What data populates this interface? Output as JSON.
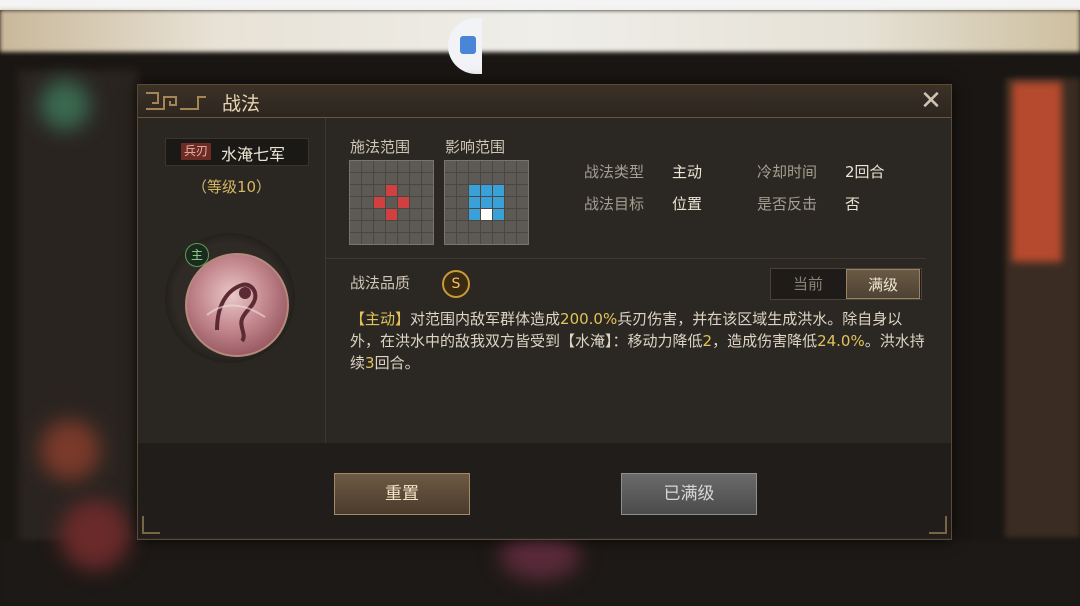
{
  "dialog": {
    "title": "战法",
    "close_icon": "close-icon"
  },
  "skill": {
    "tag": "兵刃",
    "name": "水淹七军",
    "level": "（等级10）",
    "badge": "主"
  },
  "ranges": {
    "cast_label": "施法范围",
    "effect_label": "影响范围"
  },
  "props": {
    "type_label": "战法类型",
    "type_value": "主动",
    "target_label": "战法目标",
    "target_value": "位置",
    "cooldown_label": "冷却时间",
    "cooldown_value": "2回合",
    "counter_label": "是否反击",
    "counter_value": "否"
  },
  "quality": {
    "label": "战法品质",
    "value": "S"
  },
  "toggle": {
    "current": "当前",
    "max": "满级"
  },
  "description": {
    "p1": "【主动】",
    "p2": "对范围内敌军群体造成",
    "p3": "200.0%",
    "p4": "兵刃伤害，并在该区域生成洪水。除自身以外，在洪水中的敌我双方皆受到【水淹】：移动力降低",
    "p5": "2",
    "p6": "，造成伤害降低",
    "p7": "24.0%",
    "p8": "。洪水持续",
    "p9": "3",
    "p10": "回合。"
  },
  "buttons": {
    "reset": "重置",
    "maxed": "已满级"
  },
  "colors": {
    "accent_gold": "#e3c25a",
    "cast_cell": "#d04040",
    "effect_cell": "#3aa0d8"
  }
}
